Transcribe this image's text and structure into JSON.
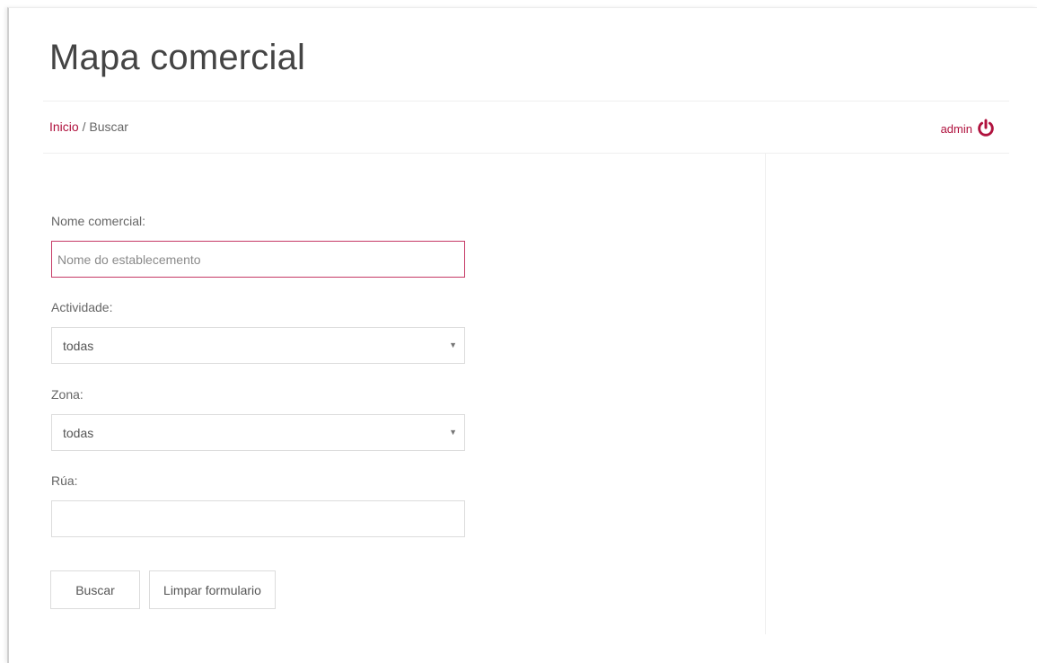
{
  "header": {
    "title": "Mapa comercial"
  },
  "breadcrumb": {
    "home": "Inicio",
    "separator": " / ",
    "current": "Buscar"
  },
  "user": {
    "name": "admin",
    "logout_icon": "power-icon",
    "accent_color": "#b0123e"
  },
  "form": {
    "name": {
      "label": "Nome comercial:",
      "value": "",
      "placeholder": "Nome do establecemento"
    },
    "activity": {
      "label": "Actividade:",
      "selected": "todas"
    },
    "zone": {
      "label": "Zona:",
      "selected": "todas"
    },
    "street": {
      "label": "Rúa:",
      "value": "",
      "placeholder": ""
    },
    "buttons": {
      "search": "Buscar",
      "clear": "Limpar formulario"
    }
  }
}
